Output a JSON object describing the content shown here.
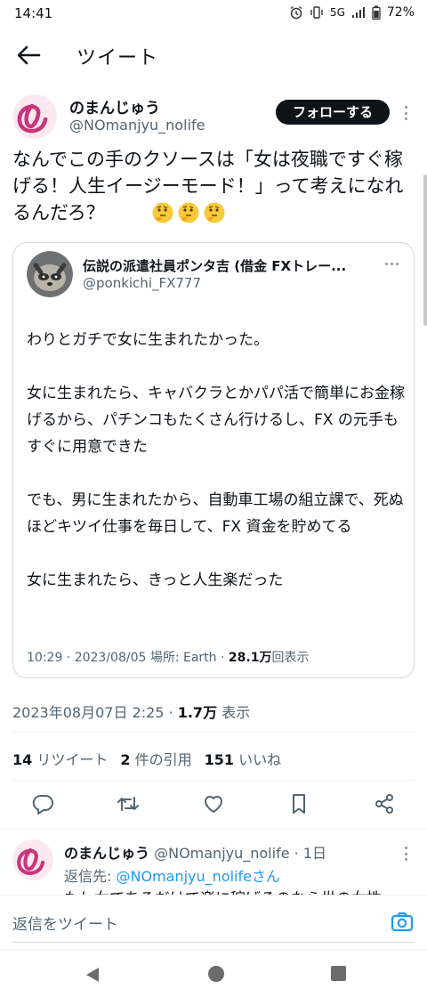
{
  "status_bar": {
    "time": "14:41",
    "network": "5G",
    "battery": "72%"
  },
  "header": {
    "title": "ツイート"
  },
  "tweet": {
    "author_name": "のまんじゅう",
    "author_handle": "@NOmanjyu_nolife",
    "follow_label": "フォローする",
    "text": "なんでこの手のクソースは「女は夜職ですぐ稼げる！人生イージーモード！」って考えになれるんだろ？",
    "emojis": [
      "🤔",
      "🤔",
      "🤔"
    ],
    "timestamp": "2023年08月07日 2:25 · ",
    "views_count": "1.7万",
    "views_label": " 表示"
  },
  "quote": {
    "author_name": "伝説の派遣社員ポンタ吉 (借金 FXトレー...",
    "author_handle": "@ponkichi_FX777",
    "text": "わりとガチで女に生まれたかった。\n\n女に生まれたら、キャバクラとかパパ活で簡単にお金稼げるから、パチンコもたくさん行けるし、FX の元手もすぐに用意できた\n\nでも、男に生まれたから、自動車工場の組立課で、死ぬほどキツイ仕事を毎日して、FX 資金を貯めてる\n\n女に生まれたら、きっと人生楽だった",
    "meta": "10:29 · 2023/08/05 場所: Earth · ",
    "views_count": "28.1万",
    "views_label": "回表示"
  },
  "stats": {
    "retweets_count": "14",
    "retweets_label": " リツイート",
    "quotes_count": "2",
    "quotes_label": " 件の引用",
    "likes_count": "151",
    "likes_label": " いいね"
  },
  "reply": {
    "author_name": "のまんじゅう",
    "author_handle_time": " @NOmanjyu_nolife · 1日",
    "reply_to_label": "返信先: ",
    "reply_to_handle": "@NOmanjyu_nolifeさん",
    "preview": "もし女であるだけで楽に稼げるのなら世の女性"
  },
  "compose": {
    "placeholder": "返信をツイート"
  },
  "icons": {
    "back": "arrow-left-icon",
    "reply": "comment-icon",
    "retweet": "retweet-icon",
    "like": "heart-icon",
    "bookmark": "bookmark-icon",
    "share": "share-icon",
    "camera": "camera-icon"
  },
  "colors": {
    "accent": "#1d9bf0",
    "avatar_pink": "#c8357a",
    "text_secondary": "#536471"
  }
}
